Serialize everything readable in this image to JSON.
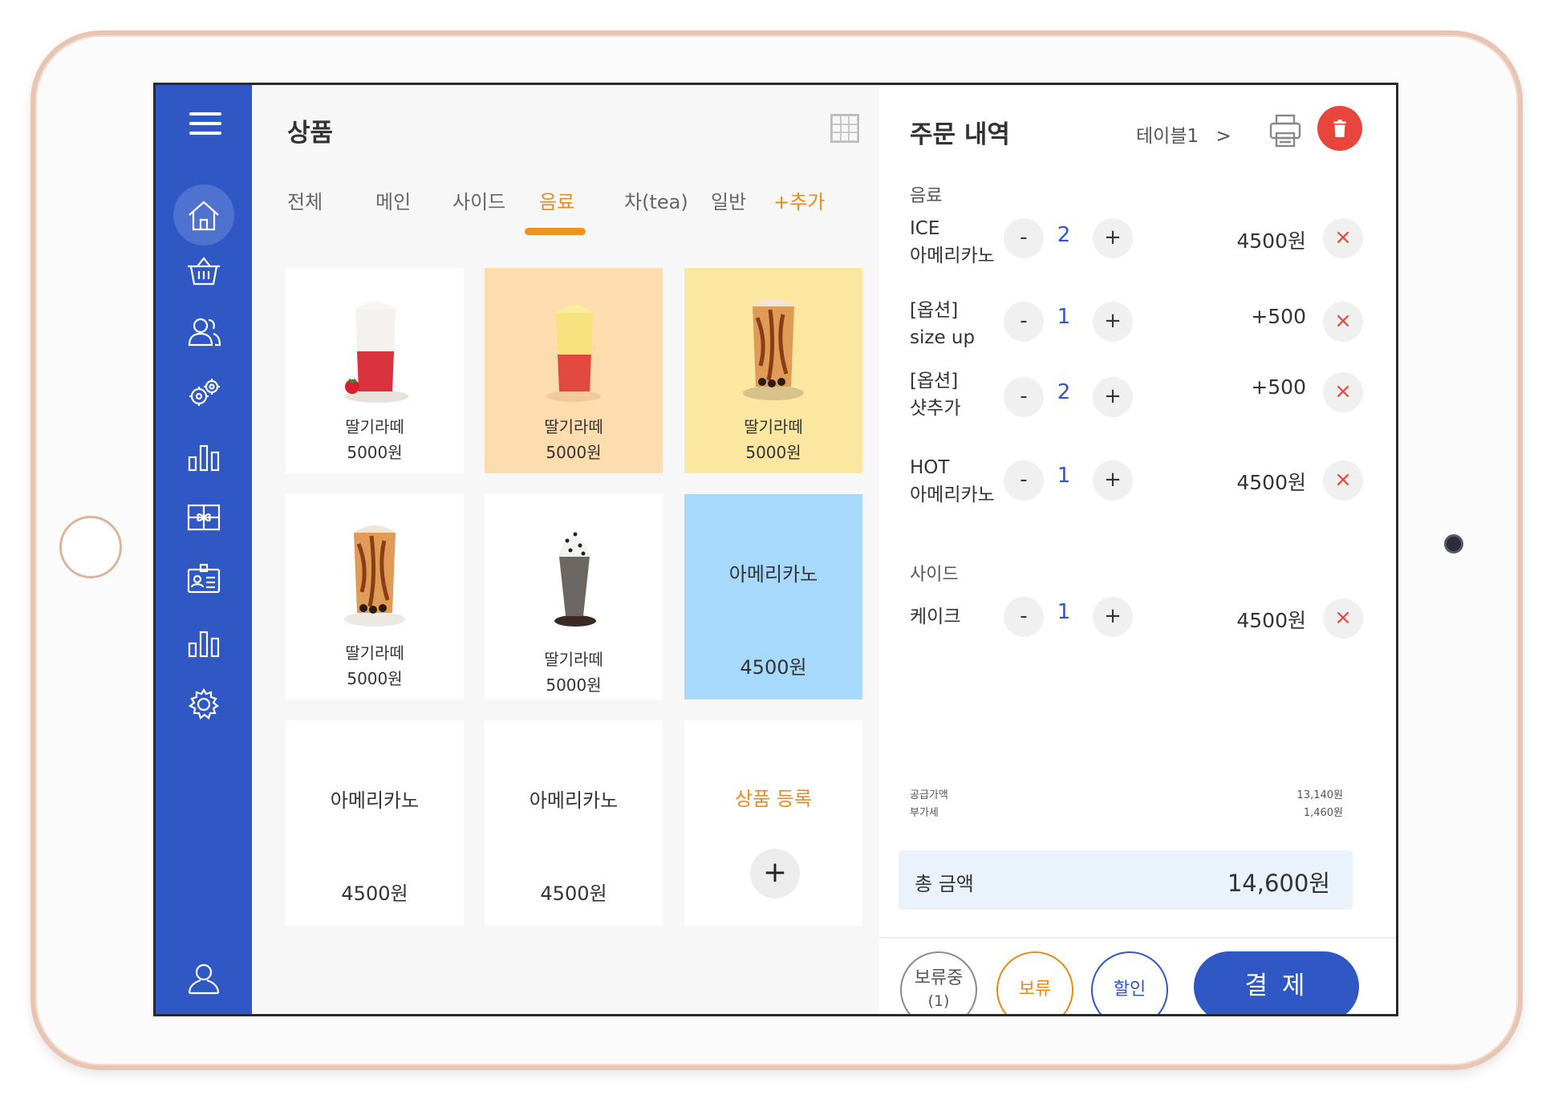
{
  "sidebar": {
    "icons": [
      "menu-icon",
      "home-icon",
      "basket-icon",
      "users-icon",
      "gears-icon",
      "bar-chart-icon",
      "gift-icon",
      "id-card-icon",
      "bar-chart-icon",
      "settings-icon",
      "user-icon"
    ]
  },
  "products": {
    "title": "상품",
    "tabs": [
      "전체",
      "메인",
      "사이드",
      "음료",
      "차(tea)",
      "일반",
      "+추가"
    ],
    "active_tab": "음료",
    "items": [
      {
        "name": "딸기라떼",
        "price": "5000원",
        "bg": "#ffffff",
        "image": "strawberry-latte"
      },
      {
        "name": "딸기라떼",
        "price": "5000원",
        "bg": "#fddcad",
        "image": "strawberry-latte"
      },
      {
        "name": "딸기라떼",
        "price": "5000원",
        "bg": "#fbe7a0",
        "image": "brown-sugar-boba"
      },
      {
        "name": "딸기라떼",
        "price": "5000원",
        "bg": "#ffffff",
        "image": "brown-sugar-boba"
      },
      {
        "name": "딸기라떼",
        "price": "5000원",
        "bg": "#ffffff",
        "image": "cookie-frappe"
      },
      {
        "name": "아메리카노",
        "price": "4500원",
        "bg": "#a6d9fc",
        "image": ""
      },
      {
        "name": "아메리카노",
        "price": "4500원",
        "bg": "#ffffff",
        "image": ""
      },
      {
        "name": "아메리카노",
        "price": "4500원",
        "bg": "#ffffff",
        "image": ""
      }
    ],
    "register": {
      "label": "상품 등록",
      "plus": "+"
    }
  },
  "order": {
    "title": "주문 내역",
    "table": "테이블1",
    "table_chevron": ">",
    "sections": [
      {
        "label": "음료",
        "items": [
          {
            "name_line1": "ICE",
            "name_line2": "아메리카노",
            "qty": "2",
            "price": "4500원"
          },
          {
            "name_line1": "[옵션]",
            "name_line2": "size up",
            "qty": "1",
            "price": "+500"
          },
          {
            "name_line1": "[옵션]",
            "name_line2": "샷추가",
            "qty": "2",
            "price": "+500"
          },
          {
            "name_line1": "HOT",
            "name_line2": "아메리카노",
            "qty": "1",
            "price": "4500원"
          }
        ]
      },
      {
        "label": "사이드",
        "items": [
          {
            "name_line1": "케이크",
            "name_line2": "",
            "qty": "1",
            "price": "4500원"
          }
        ]
      }
    ],
    "minus": "-",
    "plus": "+",
    "remove": "×",
    "summary": {
      "supply_label": "공급가액",
      "supply_value": "13,140원",
      "vat_label": "부가세",
      "vat_value": "1,460원"
    },
    "total_label": "총 금액",
    "total_value": "14,600원",
    "buttons": {
      "hold_list": "보류중",
      "hold_count": "(1)",
      "hold": "보류",
      "discount": "할인",
      "pay": "결 제"
    }
  },
  "colors": {
    "sidebar": "#2f58c4",
    "accent_orange": "#e88a1a",
    "accent_blue": "#2f58c4",
    "danger": "#e8453c"
  }
}
